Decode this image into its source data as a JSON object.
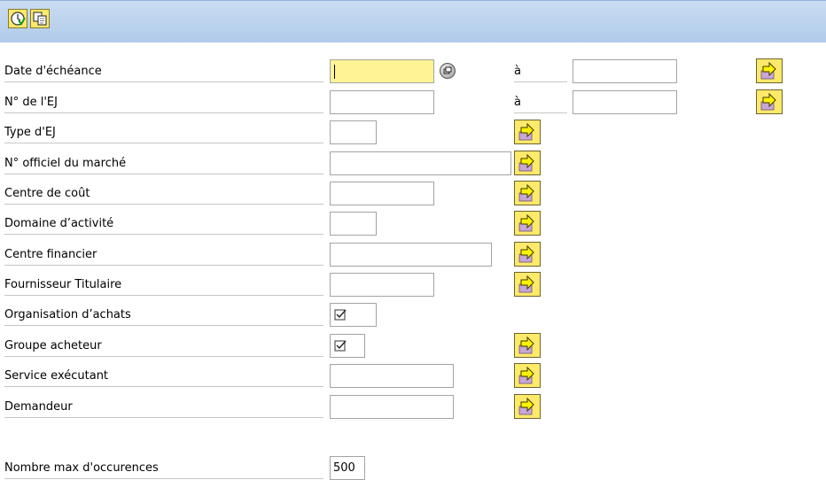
{
  "toolbar": {
    "buttons": [
      {
        "icon": "execute-clock-icon"
      },
      {
        "icon": "copy-selection-icon"
      }
    ]
  },
  "form": {
    "range_separator": "à",
    "fields": [
      {
        "label": "Date d'échéance",
        "value": "",
        "active": true
      },
      {
        "label": "N° de l'EJ",
        "value": ""
      },
      {
        "label": "Type d'EJ",
        "value": ""
      },
      {
        "label": "N° officiel du marché",
        "value": ""
      },
      {
        "label": "Centre de coût",
        "value": ""
      },
      {
        "label": "Domaine d’activité",
        "value": ""
      },
      {
        "label": "Centre financier",
        "value": ""
      },
      {
        "label": "Fournisseur Titulaire",
        "value": ""
      },
      {
        "label": "Organisation d’achats",
        "checked": true
      },
      {
        "label": "Groupe acheteur",
        "checked": true
      },
      {
        "label": "Service exécutant",
        "value": ""
      },
      {
        "label": "Demandeur",
        "value": ""
      }
    ],
    "max_occurrences": {
      "label": "Nombre max d'occurences",
      "value": "500"
    }
  },
  "colors": {
    "toolbar_bg": "#b9d1ee",
    "active_field": "#fff395",
    "button_yellow": "#fde96a"
  }
}
